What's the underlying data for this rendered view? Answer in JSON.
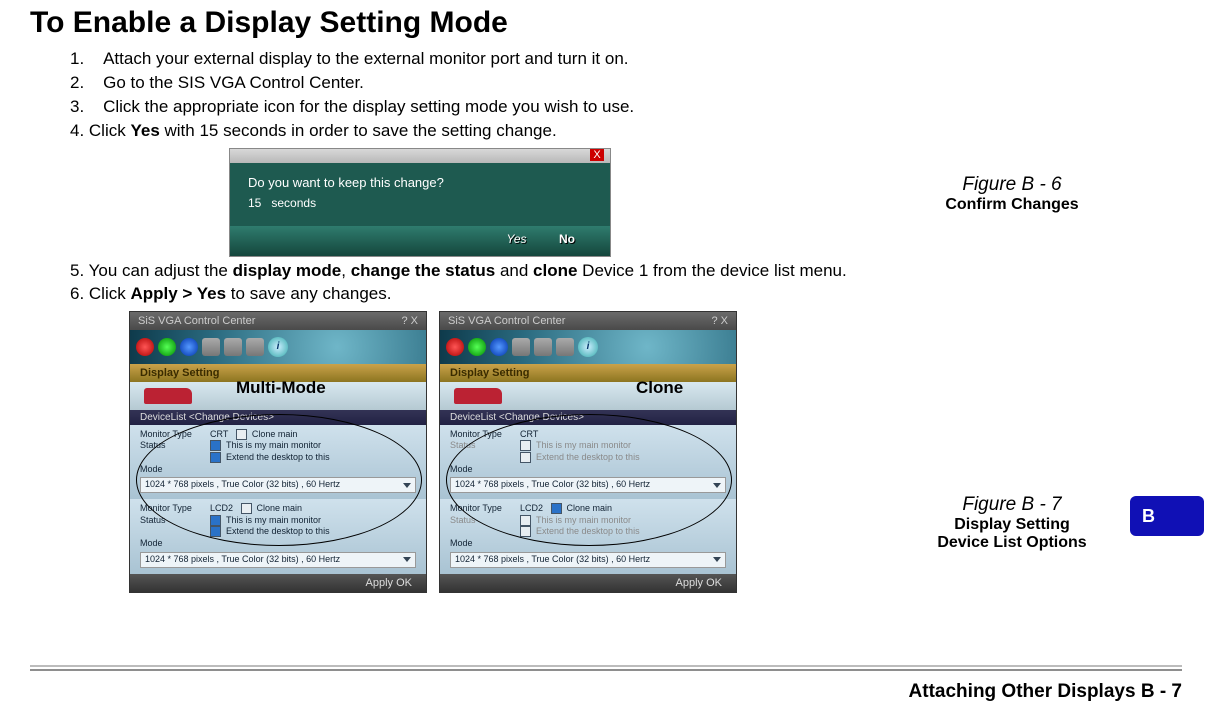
{
  "title": "To Enable a Display Setting Mode",
  "steps_a": [
    {
      "n": "1.",
      "text": "Attach your external display to the external monitor port and turn it on."
    },
    {
      "n": "2.",
      "text": "Go to the SIS VGA Control Center."
    },
    {
      "n": "3.",
      "text": "Click the appropriate icon for the display setting mode you wish to use."
    }
  ],
  "step4_prefix": "4.    Click ",
  "step4_bold": "Yes",
  "step4_suffix": " with 15 seconds in order to save the setting change.",
  "step5_prefix": "5.    You can adjust the ",
  "step5_b1": "display mode",
  "step5_mid1": ", ",
  "step5_b2": "change the status",
  "step5_mid2": " and ",
  "step5_b3": "clone",
  "step5_suffix": " Device 1 from the device list menu.",
  "step6_prefix": "6.    Click ",
  "step6_bold": "Apply > Yes",
  "step6_suffix": " to save any changes.",
  "dialog": {
    "close": "X",
    "question": "Do you want to keep this change?",
    "seconds_num": "15",
    "seconds_label": "seconds",
    "yes": "Yes",
    "no": "No"
  },
  "fig1": {
    "caption": "Figure B - 6",
    "desc": "Confirm Changes"
  },
  "fig2": {
    "caption": "Figure B - 7",
    "desc1": "Display Setting",
    "desc2": "Device List Options"
  },
  "thumbtab": "B",
  "panel_common": {
    "app_title": "SiS VGA Control Center",
    "qx": "?  X",
    "i": "i",
    "sub": "Display Setting",
    "dev_line": "DeviceList   <Change  Devices>",
    "labels": {
      "monitor_type": "Monitor Type",
      "status": "Status",
      "mode": "Mode"
    },
    "opts": {
      "clone_main": "Clone main",
      "main_monitor": "This is my main monitor",
      "extend": "Extend the desktop to this"
    },
    "mode_value": "1024 * 768 pixels , True Color (32 bits) , 60 Hertz",
    "mon1": "CRT",
    "mon2": "LCD2",
    "footer": "Apply   OK"
  },
  "overlay": {
    "multi": "Multi-Mode",
    "clone": "Clone"
  },
  "footer": {
    "text": "Attaching Other Displays  B  -  7"
  }
}
